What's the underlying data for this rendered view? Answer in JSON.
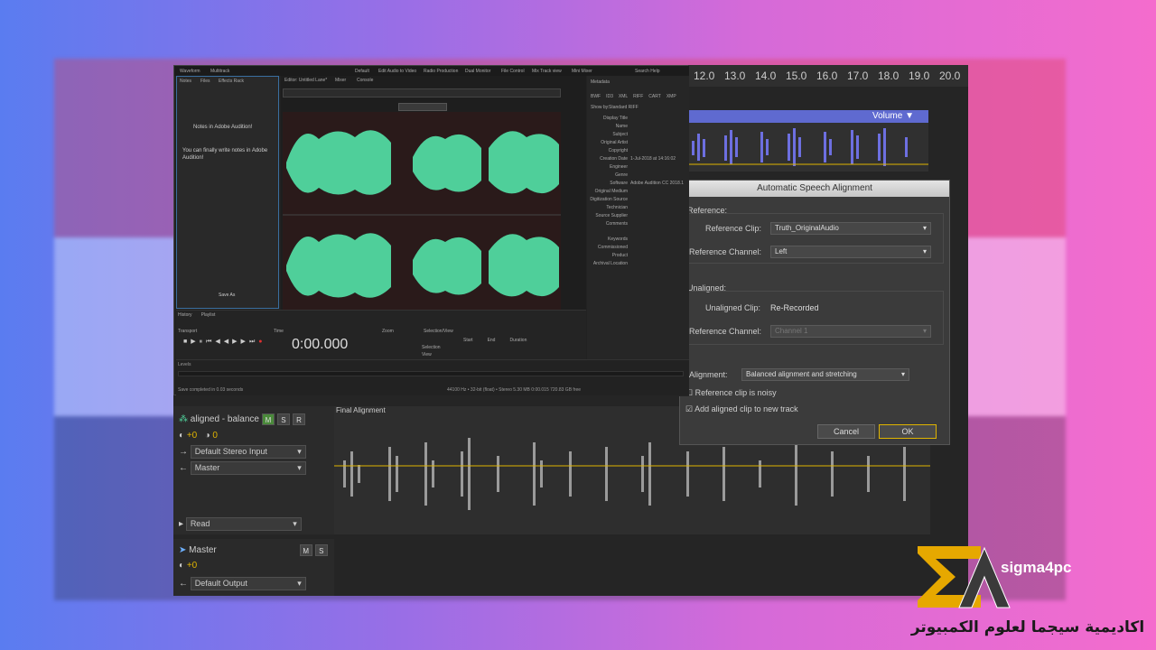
{
  "ruler": {
    "ticks": [
      "12.0",
      "13.0",
      "14.0",
      "15.0",
      "16.0",
      "17.0",
      "18.0",
      "19.0",
      "20.0"
    ]
  },
  "volume_lane": {
    "label": "Volume ▼"
  },
  "dialog": {
    "title": "Automatic Speech Alignment",
    "reference_header": "Reference:",
    "reference_clip_label": "Reference Clip:",
    "reference_clip_value": "Truth_OriginalAudio",
    "reference_channel_label": "Reference Channel:",
    "reference_channel_value": "Left",
    "unaligned_header": "Unaligned:",
    "unaligned_clip_label": "Unaligned Clip:",
    "unaligned_clip_value": "Re-Recorded",
    "unaligned_channel_label": "Reference Channel:",
    "unaligned_channel_value": "Channel 1",
    "alignment_label": "Alignment:",
    "alignment_value": "Balanced alignment and stretching",
    "noisy_label": "Reference clip is noisy",
    "add_track_label": "Add aligned clip to new track",
    "cancel": "Cancel",
    "ok": "OK"
  },
  "track": {
    "name": "aligned - balance",
    "m": "M",
    "s": "S",
    "r": "R",
    "volume": "+0",
    "pan": "0",
    "input": "Default Stereo Input",
    "output": "Master",
    "automation": "Read",
    "clip_label": "Final Alignment"
  },
  "master": {
    "name": "Master",
    "m": "M",
    "s": "S",
    "volume": "+0",
    "output": "Default Output"
  },
  "front": {
    "menu": [
      "Waveform",
      "Multitrack",
      "Default",
      "Edit Audio to Video",
      "Radio Production",
      "Dual Monitor",
      "File Control",
      "Mix Track view",
      "Mini Mixer",
      "Search Help"
    ],
    "notes_tabs": [
      "Notes",
      "Files",
      "Effects Rack"
    ],
    "notes_heading": "Notes in Adobe Audition!",
    "notes_body": "You can finally write notes in Adobe Audition!",
    "notes_button": "Save As",
    "editor_tab": "Editor: Untitled Lane*",
    "editor_tabs2": [
      "Mixer",
      "Console"
    ],
    "meta_title": "Metadata",
    "meta_tabs": [
      "BWF",
      "ID3",
      "XML",
      "RIFF",
      "CART",
      "XMP"
    ],
    "meta_showby": "Show by:",
    "meta_showby_value": "Standard RIFF",
    "meta_labels": [
      "Display Title",
      "Name",
      "Subject",
      "Original Artist",
      "Copyright",
      "Creation Date",
      "Engineer",
      "Genre",
      "Software",
      "Original Medium",
      "Digitization Source",
      "Technician",
      "Source Supplier",
      "Comments",
      "Keywords",
      "Commissioned",
      "Product",
      "Archival Location"
    ],
    "meta_values": {
      "creation": "1-Jul-2018 at 14:16:02",
      "software": "Adobe Audition CC 2018.1"
    },
    "history_tabs": [
      "History",
      "Playlist"
    ],
    "transport": "Transport",
    "time_label": "Time",
    "timecode": "0:00.000",
    "zoom": "Zoom",
    "selection": "Selection/View",
    "sel_headers": [
      "Start",
      "End",
      "Duration"
    ],
    "sel_rows": [
      "Selection",
      "View"
    ],
    "levels": "Levels",
    "status": "Save completed in 0.03 seconds",
    "status_right": "44100 Hz • 32-bit (float) • Stereo   5.30 MB   0:00.015   720.83 GB free"
  },
  "logo": {
    "brand": "sigma4pc",
    "arabic": "اكاديمية سيجما لعلوم الكمبيوتر"
  },
  "colors": {
    "waveform_green": "#4fcf9a",
    "waveform_blue": "#6d6fe0",
    "clip_gray": "#9a9a9a",
    "accent_yellow": "#e0b400"
  }
}
